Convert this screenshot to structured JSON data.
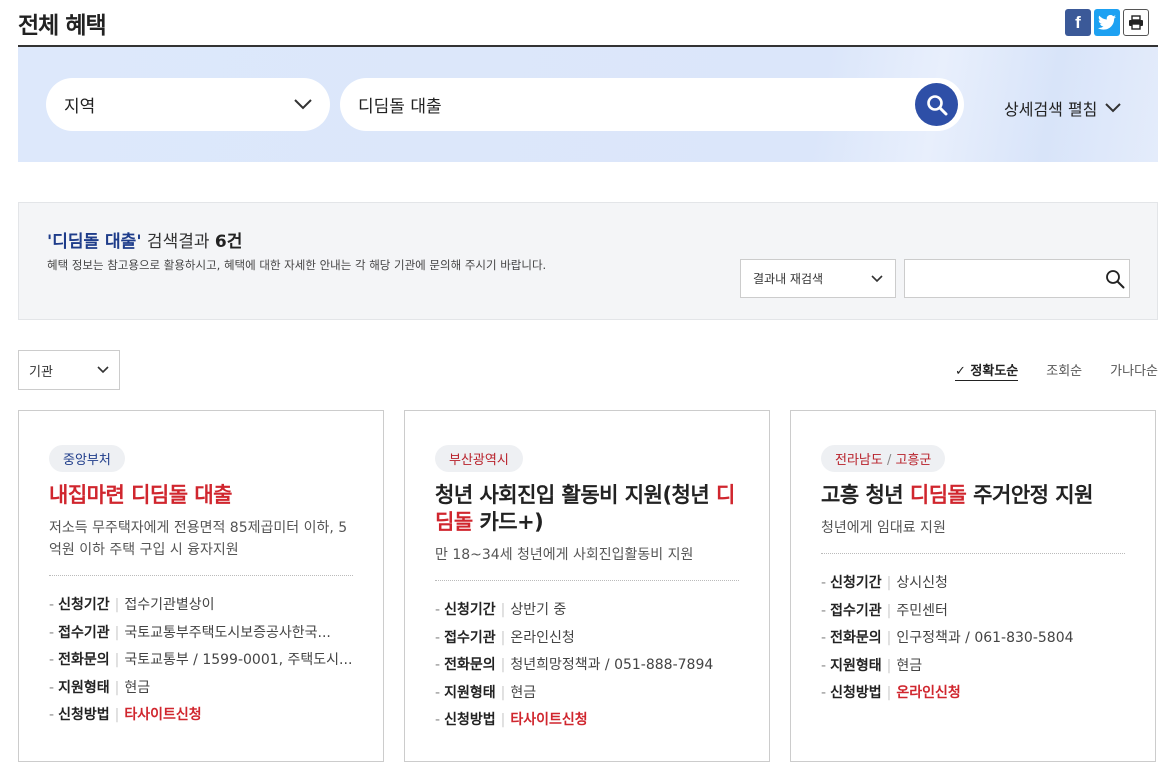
{
  "page": {
    "title": "전체 혜택"
  },
  "share": {
    "facebook": "f",
    "twitter": "t",
    "print": "print"
  },
  "search": {
    "region_label": "지역",
    "keyword_value": "디딤돌 대출",
    "advanced_label": "상세검색 펼침"
  },
  "results": {
    "keyword_quoted": "'디딤돌 대출'",
    "label": " 검색결과 ",
    "count": "6건",
    "note": "혜택 정보는 참고용으로 활용하시고, 혜택에 대한 자세한 안내는 각 해당 기관에 문의해 주시기 바랍니다.",
    "refine_select": "결과내 재검색",
    "refine_placeholder": ""
  },
  "filter": {
    "agency_label": "기관"
  },
  "sort": {
    "accuracy": "정확도순",
    "views": "조회순",
    "alpha": "가나다순",
    "check_mark": "✓"
  },
  "card_fields": {
    "period": "신청기간",
    "agency": "접수기관",
    "phone": "전화문의",
    "type": "지원형태",
    "method": "신청방법"
  },
  "cards": [
    {
      "tag_a": "중앙부처",
      "tag_b": "",
      "title_pre": "",
      "title_hl": "내집마련 디딤돌 대출",
      "title_post": "",
      "desc": "저소득 무주택자에게 전용면적 85제곱미터 이하, 5억원 이하 주택 구입 시 융자지원",
      "period": "접수기관별상이",
      "agency": "국토교통부주택도시보증공사한국...",
      "phone": "국토교통부 / 1599-0001, 주택도시...",
      "type": "현금",
      "method": "타사이트신청"
    },
    {
      "tag_a": "부산광역시",
      "tag_b": "",
      "title_pre": "청년 사회진입 활동비 지원(청년 ",
      "title_hl": "디딤돌",
      "title_post": " 카드+)",
      "desc": "만 18~34세 청년에게 사회진입활동비 지원",
      "period": "상반기 중",
      "agency": "온라인신청",
      "phone": "청년희망정책과 / 051-888-7894",
      "type": "현금",
      "method": "타사이트신청"
    },
    {
      "tag_a": "전라남도",
      "tag_b": "고흥군",
      "title_pre": "고흥 청년 ",
      "title_hl": "디딤돌",
      "title_post": " 주거안정 지원",
      "desc": "청년에게 임대료 지원",
      "period": "상시신청",
      "agency": "주민센터",
      "phone": "인구정책과 / 061-830-5804",
      "type": "현금",
      "method": "온라인신청"
    }
  ],
  "colors": {
    "accent_navy": "#2e4fa7",
    "highlight_red": "#d0262e",
    "band_bg": "#dde8fb"
  }
}
